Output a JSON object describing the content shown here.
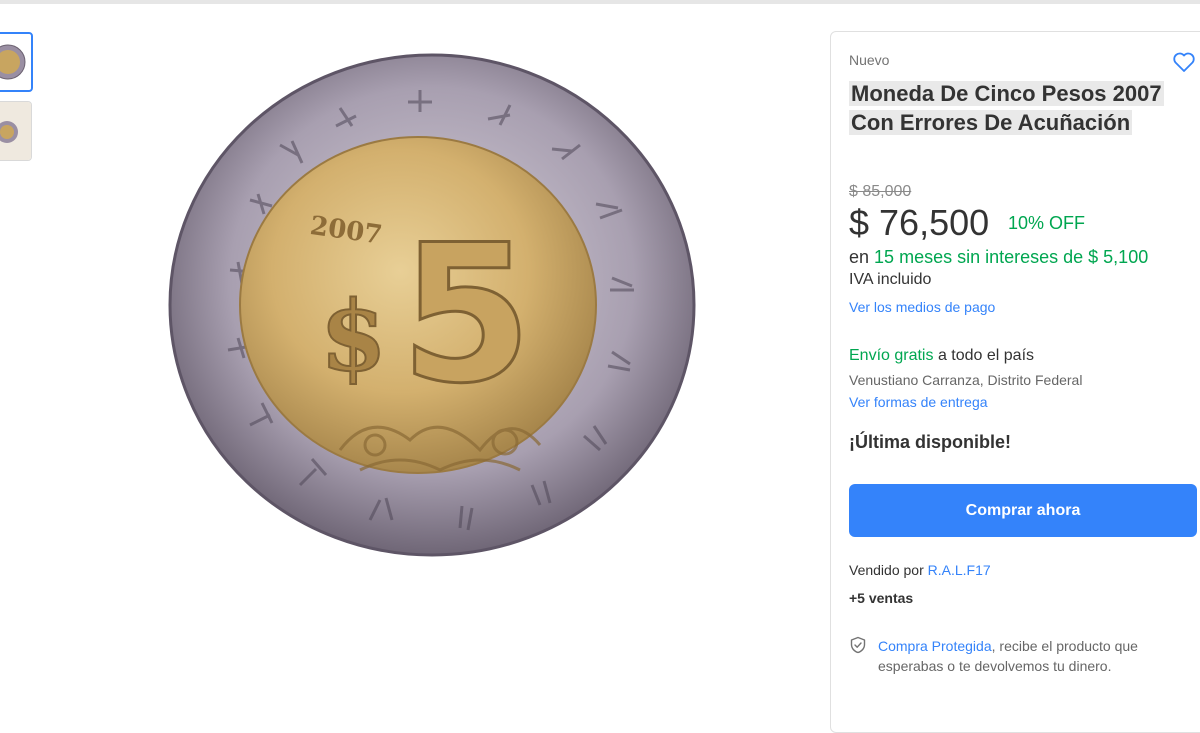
{
  "product": {
    "condition": "Nuevo",
    "title": "Moneda De Cinco Pesos 2007 Con Errores De Acuñación",
    "original_price": "$ 85,000",
    "price": "$ 76,500",
    "discount": "10% OFF",
    "installments_prefix": "en",
    "installments_text": "15 meses sin intereses de $ 5,100",
    "tax_note": "IVA incluido",
    "payment_link": "Ver los medios de pago"
  },
  "shipping": {
    "free_label": "Envío gratis",
    "scope": "a todo el país",
    "location": "Venustiano Carranza, Distrito Federal",
    "delivery_link": "Ver formas de entrega"
  },
  "stock": "¡Última disponible!",
  "buy_button": "Comprar ahora",
  "seller": {
    "label": "Vendido por",
    "name": "R.A.L.F17",
    "sales": "+5 ventas"
  },
  "protection": {
    "link": "Compra Protegida",
    "text": ", recibe el producto que esperabas o te devolvemos tu dinero."
  },
  "coin": {
    "year": "2007",
    "symbol": "$",
    "denomination": "5"
  },
  "icons": [
    "heart-icon",
    "shield-check-icon"
  ],
  "colors": {
    "accent": "#3483fa",
    "green": "#00a650"
  }
}
